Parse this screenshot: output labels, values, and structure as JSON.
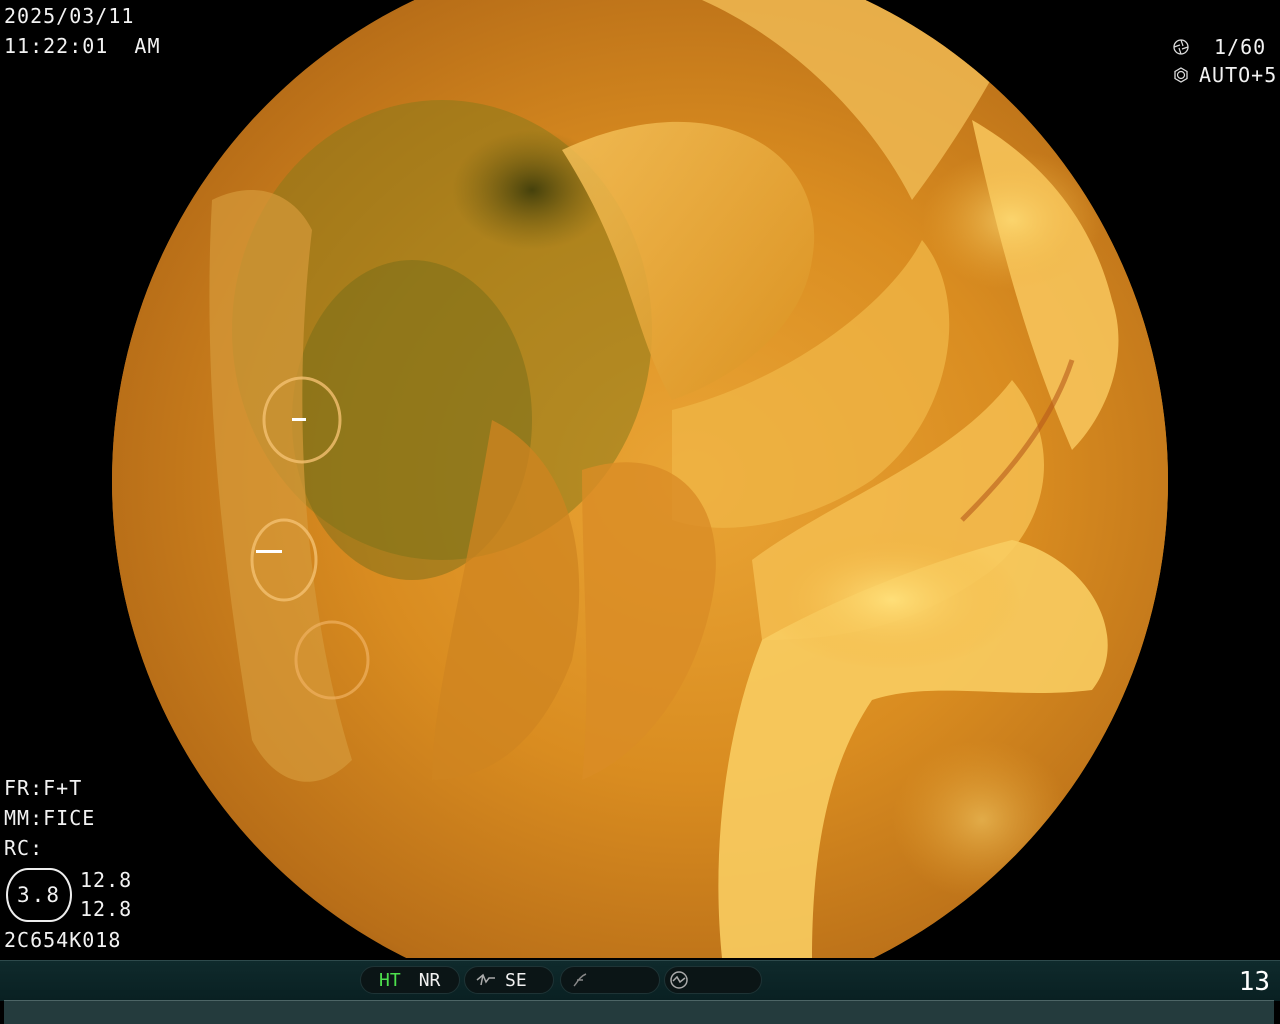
{
  "header": {
    "date": "2025/03/11",
    "time": "11:22:01  AM"
  },
  "camera": {
    "shutter": "1/60",
    "iris": "AUTO+5",
    "shutter_icon": "aperture-icon",
    "iris_icon": "iris-icon"
  },
  "settings": {
    "fr": "FR:F+T",
    "mm": "MM:FICE",
    "rc": "RC:",
    "rc_badge": "3.8",
    "rc_value_1": "12.8",
    "rc_value_2": "12.8",
    "serial": "2C654K018"
  },
  "status_bar": {
    "ht": "HT",
    "nr": "NR",
    "se": "SE",
    "page": "13",
    "structure_icon": "structure-enhance-icon",
    "color_icon": "color-enhance-icon",
    "mode_icon": "mode-circle-icon"
  },
  "colors": {
    "ht_active": "#4de04d",
    "bar_bg": "#0f2a2c"
  }
}
